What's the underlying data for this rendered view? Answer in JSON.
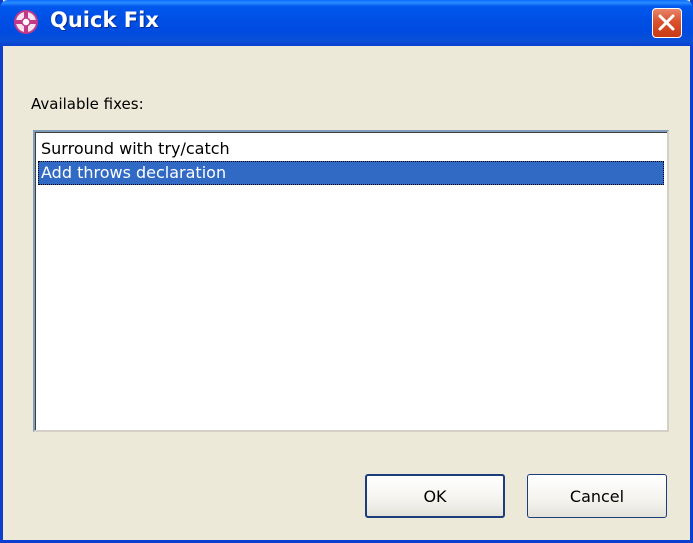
{
  "window": {
    "title": "Quick Fix",
    "icon": "quick-fix-icon",
    "close_icon": "close-icon"
  },
  "content": {
    "available_label": "Available fixes:",
    "fixes": [
      {
        "label": "Surround with try/catch",
        "selected": false
      },
      {
        "label": "Add throws declaration",
        "selected": true
      }
    ]
  },
  "buttons": {
    "ok": "OK",
    "cancel": "Cancel"
  },
  "colors": {
    "titlebar": "#0054e3",
    "selection": "#316ac5",
    "close_button": "#d9522e"
  }
}
